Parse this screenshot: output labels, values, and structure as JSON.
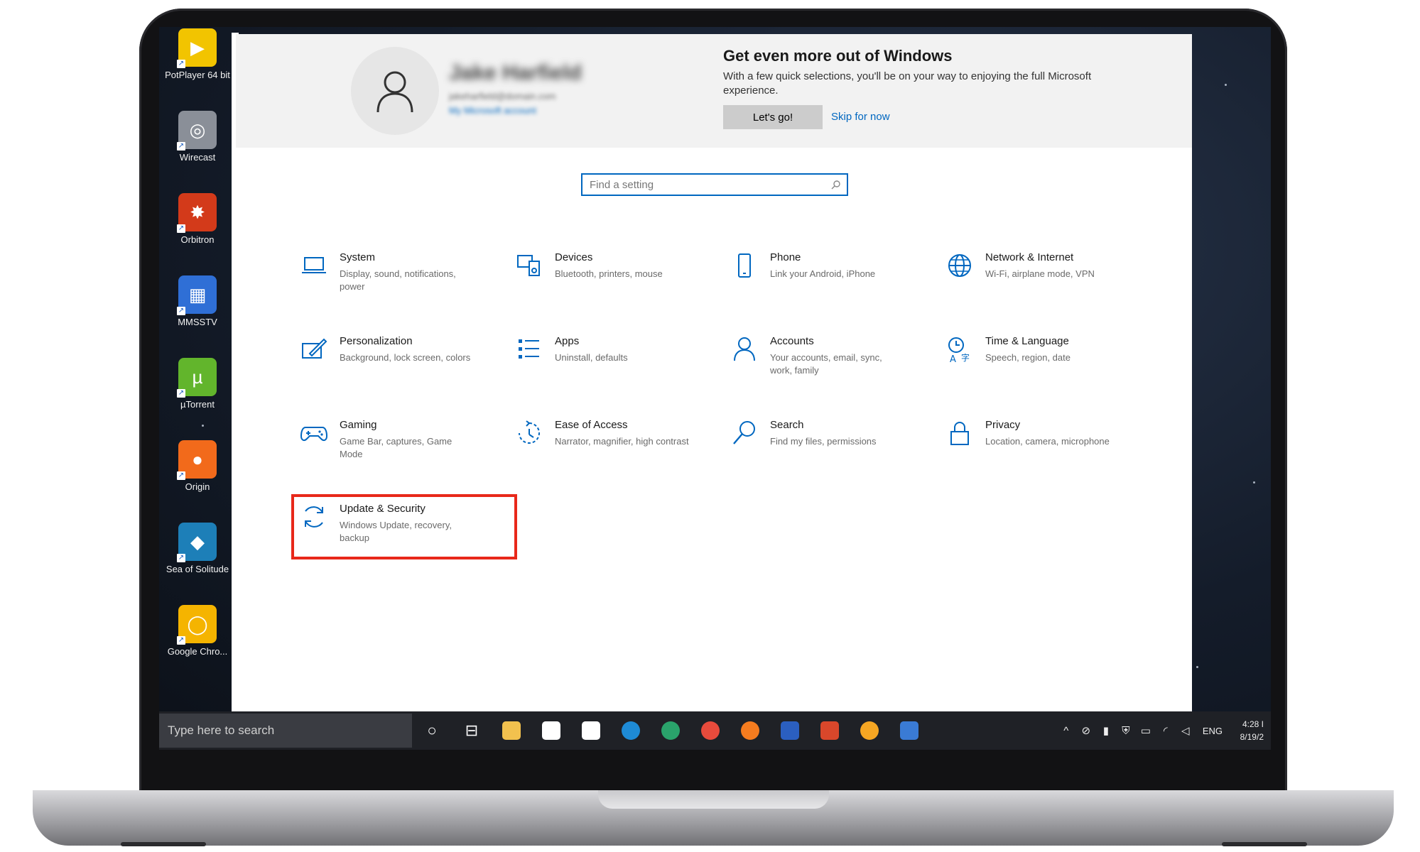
{
  "desktop": {
    "icons": [
      {
        "label": "PotPlayer 64 bit",
        "color": "#f2c400",
        "glyph": "▶"
      },
      {
        "label": "Wirecast",
        "color": "#8a8f98",
        "glyph": "◎"
      },
      {
        "label": "Orbitron",
        "color": "#d33a1a",
        "glyph": "✸"
      },
      {
        "label": "MMSSTV",
        "color": "#2f6fd6",
        "glyph": "▦"
      },
      {
        "label": "µTorrent",
        "color": "#62b52c",
        "glyph": "µ"
      },
      {
        "label": "Origin",
        "color": "#f26a1b",
        "glyph": "●"
      },
      {
        "label": "Sea of Solitude",
        "color": "#1d7fb8",
        "glyph": "◆"
      },
      {
        "label": "Google Chro...",
        "color": "#f5b400",
        "glyph": "◯"
      }
    ]
  },
  "account": {
    "name": "Jake Harfield",
    "email": "jakeharfield@domain.com",
    "link": "My Microsoft account"
  },
  "promo": {
    "title": "Get even more out of Windows",
    "text": "With a few quick selections, you'll be on your way to enjoying the full Microsoft experience.",
    "primary_button": "Let's go!",
    "skip_link": "Skip for now"
  },
  "search": {
    "placeholder": "Find a setting"
  },
  "categories": [
    {
      "title": "System",
      "desc": "Display, sound, notifications, power",
      "icon": "laptop-icon"
    },
    {
      "title": "Devices",
      "desc": "Bluetooth, printers, mouse",
      "icon": "devices-icon"
    },
    {
      "title": "Phone",
      "desc": "Link your Android, iPhone",
      "icon": "phone-icon"
    },
    {
      "title": "Network & Internet",
      "desc": "Wi-Fi, airplane mode, VPN",
      "icon": "globe-icon"
    },
    {
      "title": "Personalization",
      "desc": "Background, lock screen, colors",
      "icon": "paint-icon"
    },
    {
      "title": "Apps",
      "desc": "Uninstall, defaults",
      "icon": "apps-list-icon"
    },
    {
      "title": "Accounts",
      "desc": "Your accounts, email, sync, work, family",
      "icon": "person-icon"
    },
    {
      "title": "Time & Language",
      "desc": "Speech, region, date",
      "icon": "time-language-icon"
    },
    {
      "title": "Gaming",
      "desc": "Game Bar, captures, Game Mode",
      "icon": "gamepad-icon"
    },
    {
      "title": "Ease of Access",
      "desc": "Narrator, magnifier, high contrast",
      "icon": "ease-of-access-icon"
    },
    {
      "title": "Search",
      "desc": "Find my files, permissions",
      "icon": "magnifier-icon"
    },
    {
      "title": "Privacy",
      "desc": "Location, camera, microphone",
      "icon": "lock-icon"
    },
    {
      "title": "Update & Security",
      "desc": "Windows Update, recovery, backup",
      "icon": "sync-icon"
    }
  ],
  "taskbar": {
    "search_placeholder": "Type here to search",
    "apps": [
      {
        "name": "file-explorer",
        "color": "#f2c14e"
      },
      {
        "name": "store",
        "color": "#ffffff"
      },
      {
        "name": "mail",
        "color": "#ffffff"
      },
      {
        "name": "edge",
        "color": "#1e8bd6"
      },
      {
        "name": "edge-beta",
        "color": "#2aa36b"
      },
      {
        "name": "chrome",
        "color": "#e84b3c"
      },
      {
        "name": "firefox",
        "color": "#f57c1f"
      },
      {
        "name": "word",
        "color": "#2b5fc0"
      },
      {
        "name": "powerpoint",
        "color": "#d9472b"
      },
      {
        "name": "canary",
        "color": "#f5a623"
      },
      {
        "name": "remote-desktop",
        "color": "#3a7bd5"
      }
    ],
    "language": "ENG",
    "time": "4:28 I",
    "date": "8/19/2"
  },
  "colors": {
    "accent": "#0067c0",
    "highlight": "#e8281a"
  }
}
